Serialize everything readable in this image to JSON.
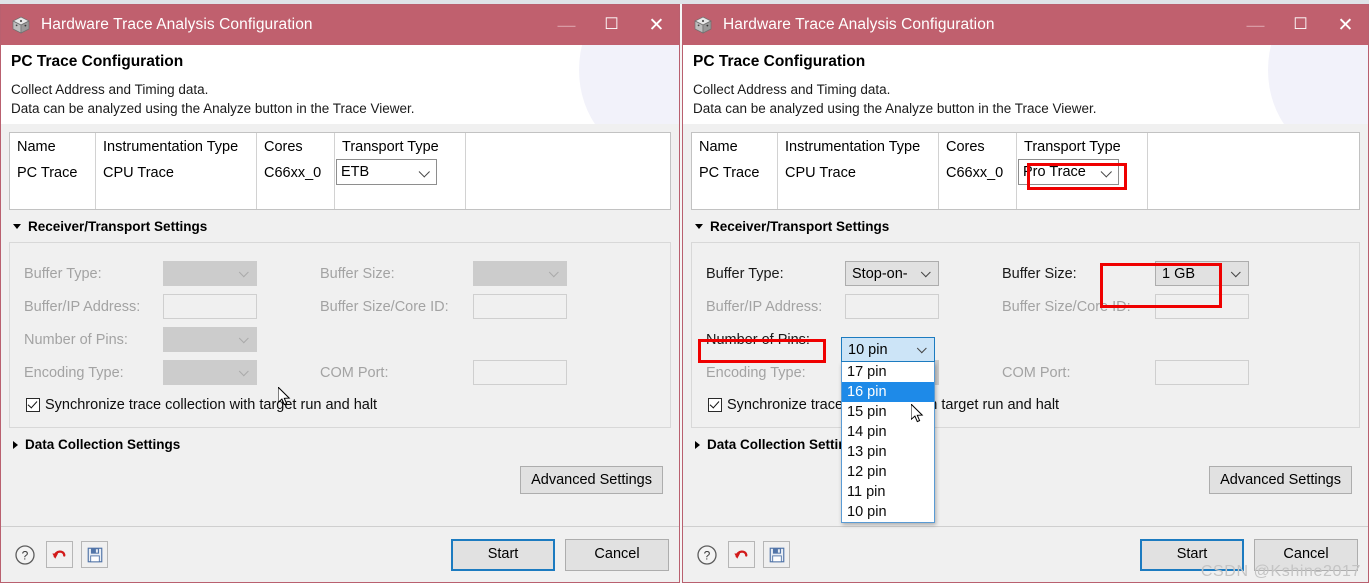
{
  "window": {
    "title": "Hardware Trace Analysis Configuration",
    "icon": "ti-cube-icon",
    "minimize_label": "—",
    "maximize_label": "☐",
    "close_label": "✕",
    "titlebar_color": "#c0606e"
  },
  "page": {
    "title": "PC Trace Configuration",
    "desc_line1": "Collect Address and Timing data.",
    "desc_line2": "Data can be analyzed using the Analyze button in the Trace Viewer."
  },
  "table": {
    "headers": [
      "Name",
      "Instrumentation Type",
      "Cores",
      "Transport Type",
      ""
    ],
    "row": {
      "name": "PC Trace",
      "instrumentation_type": "CPU Trace",
      "cores": "C66xx_0"
    },
    "transport_left": "ETB",
    "transport_right": "Pro Trace"
  },
  "sections": {
    "receiver": "Receiver/Transport Settings",
    "data_collection": "Data Collection Settings"
  },
  "form": {
    "buffer_type_label": "Buffer Type:",
    "buffer_size_label": "Buffer Size:",
    "buffer_ip_label": "Buffer/IP Address:",
    "buffer_size_core_label": "Buffer Size/Core ID:",
    "number_of_pins_label": "Number of Pins:",
    "encoding_type_label": "Encoding Type:",
    "com_port_label": "COM Port:",
    "sync_label": "Synchronize trace collection with target run and halt",
    "sync_label_right_part": "with target run and halt",
    "sync_label_right_head": "Synchronize tra",
    "left_values": {
      "buffer_type": "",
      "buffer_size": "",
      "buffer_ip": "",
      "buffer_size_core": "",
      "number_of_pins": "",
      "encoding_type": "",
      "com_port": ""
    },
    "right_values": {
      "buffer_type": "Stop-on-",
      "buffer_size": "1 GB",
      "buffer_ip": "",
      "buffer_size_core": "",
      "number_of_pins": "10 pin",
      "encoding_type": "",
      "com_port": ""
    }
  },
  "dropdown": {
    "selected_display": "10 pin",
    "highlighted": "16 pin",
    "options": [
      "17 pin",
      "16 pin",
      "15 pin",
      "14 pin",
      "13 pin",
      "12 pin",
      "11 pin",
      "10 pin"
    ]
  },
  "buttons": {
    "advanced": "Advanced Settings",
    "start": "Start",
    "cancel": "Cancel"
  },
  "footer_icons": {
    "help": "help-icon",
    "revert": "revert-icon",
    "save": "save-icon"
  },
  "annotations": {
    "color": "#ef0000",
    "boxes": [
      "transport-type-cell",
      "buffer-size-combo",
      "number-of-pins-label"
    ]
  },
  "watermark": "CSDN @Kshine2017"
}
